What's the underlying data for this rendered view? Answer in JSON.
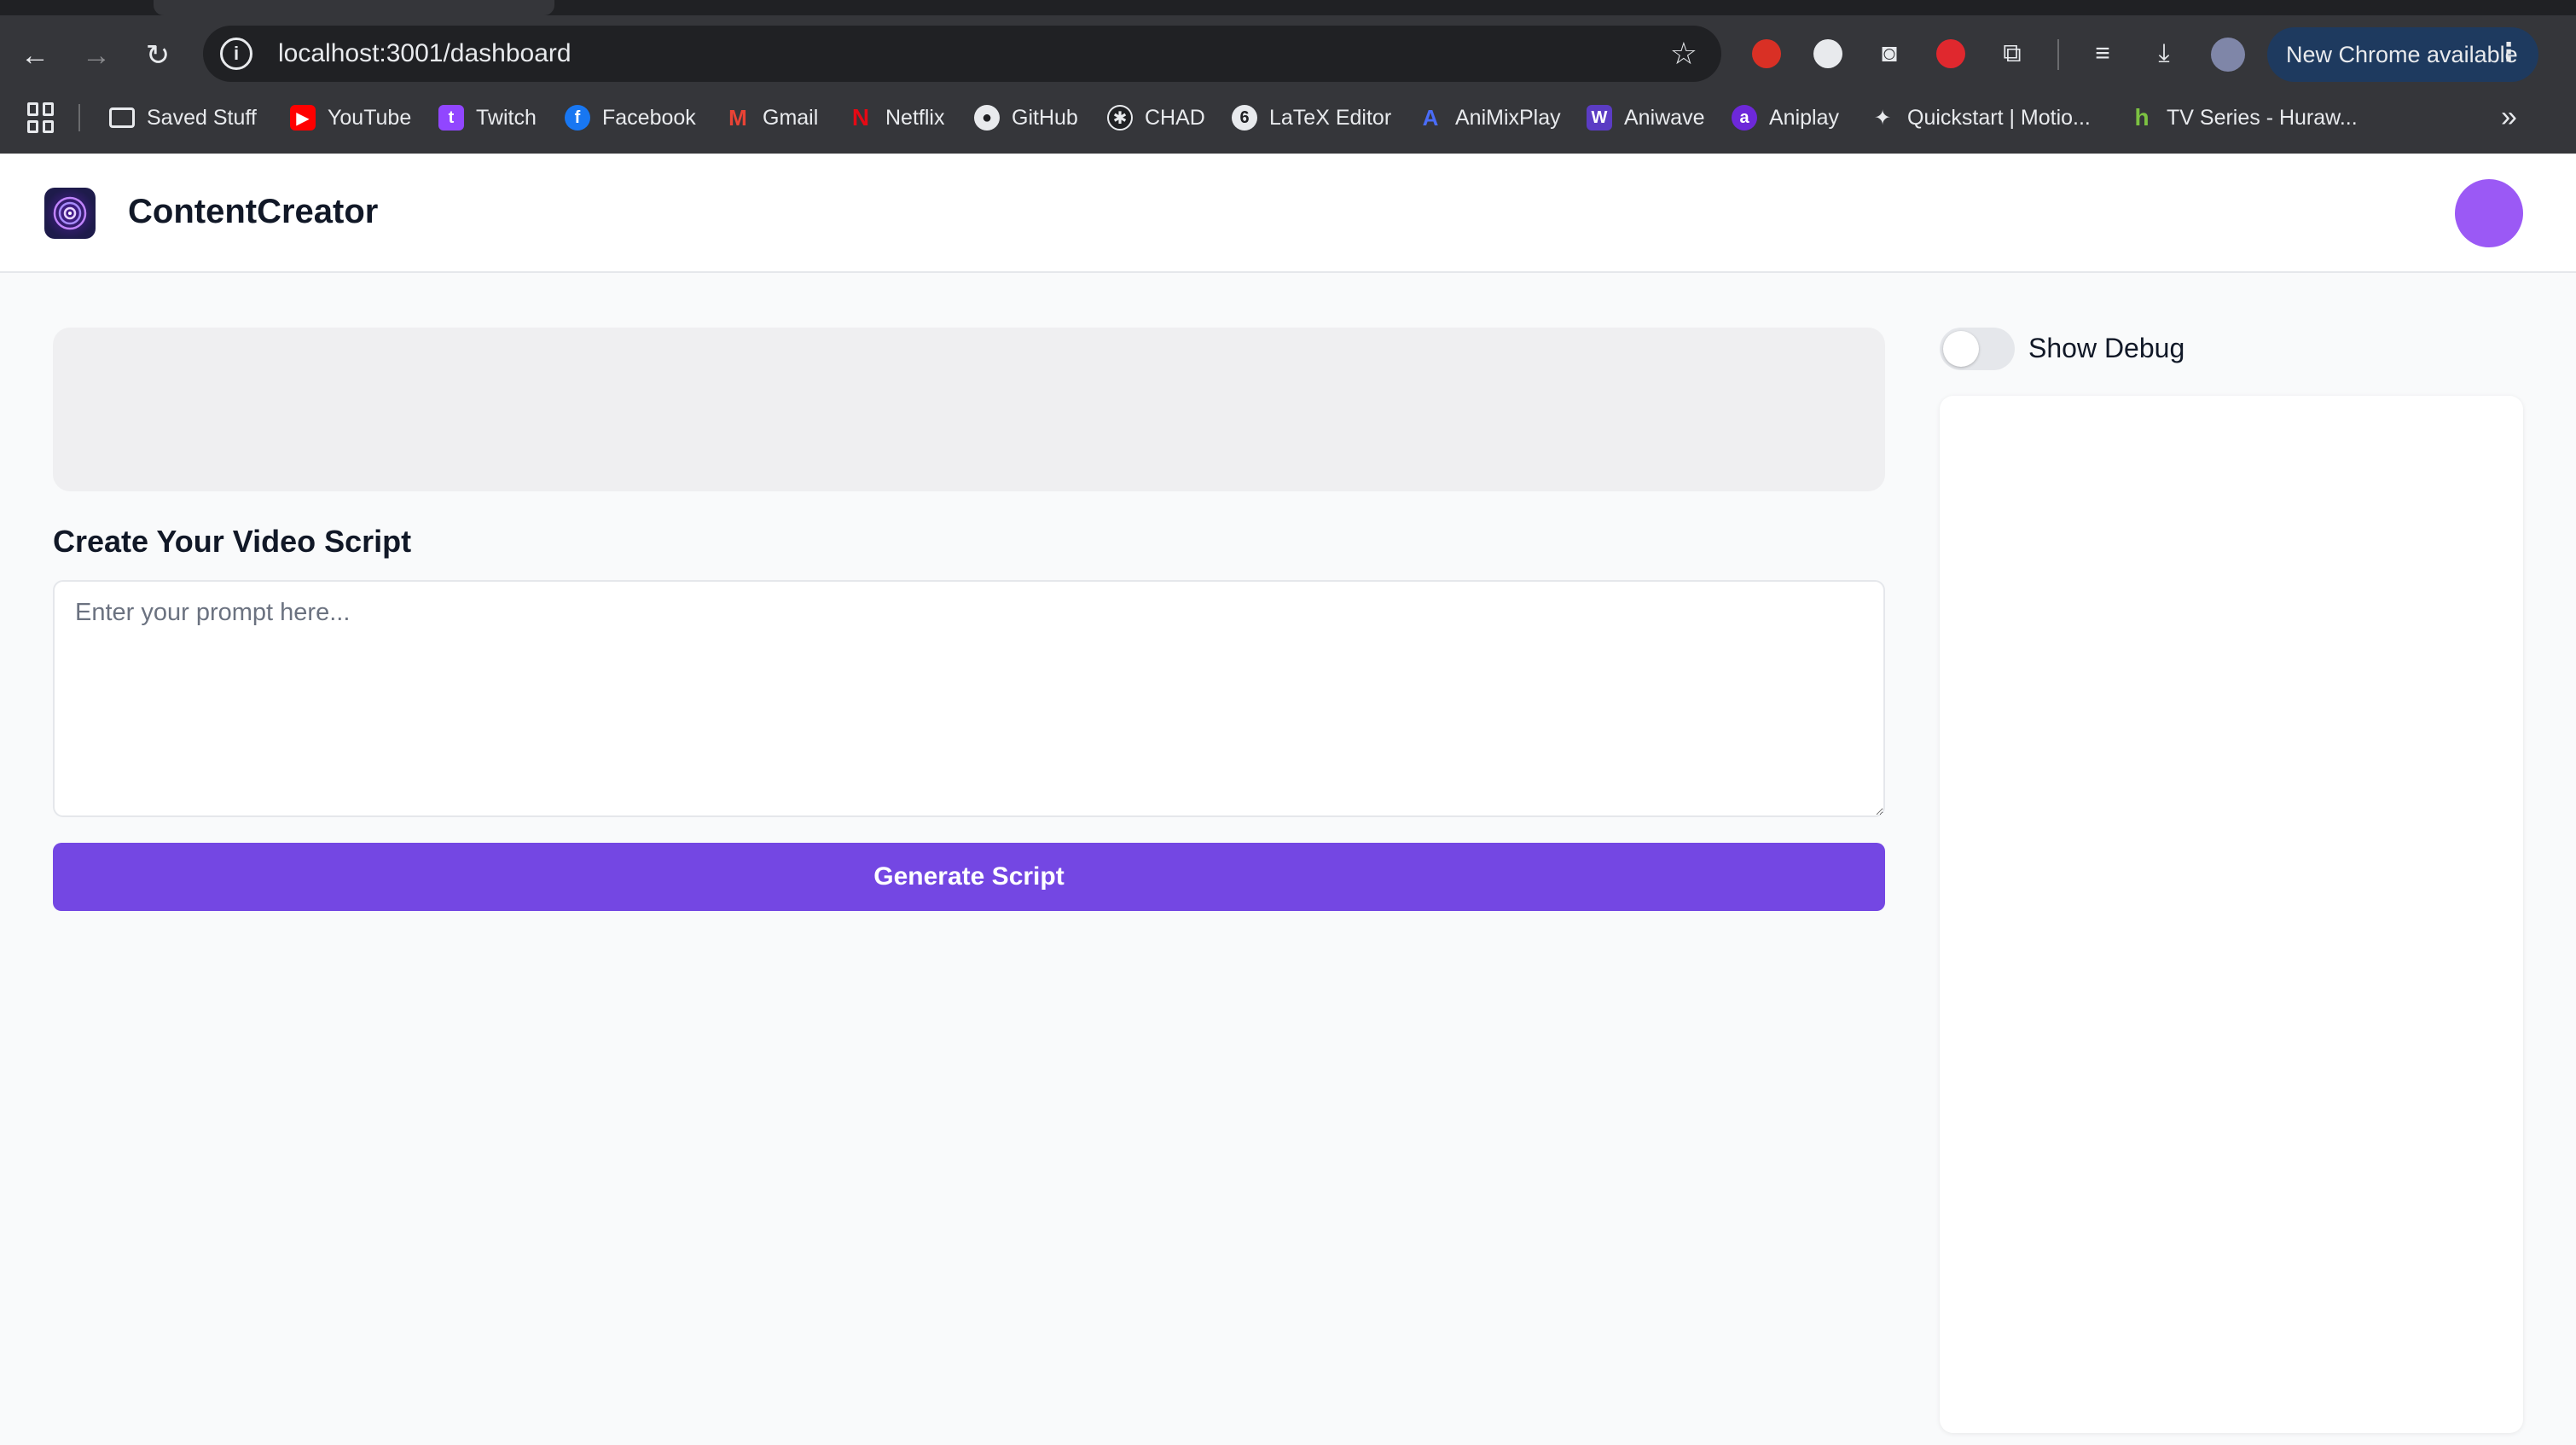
{
  "browser": {
    "url": "localhost:3001/dashboard",
    "update_label": "New Chrome available",
    "bookmarks": [
      {
        "label": "Saved Stuff",
        "icon": "folder-icon"
      },
      {
        "label": "YouTube",
        "icon": "youtube-icon",
        "color": "#ff0000"
      },
      {
        "label": "Twitch",
        "icon": "twitch-icon",
        "color": "#9146ff"
      },
      {
        "label": "Facebook",
        "icon": "facebook-icon",
        "color": "#1877f2"
      },
      {
        "label": "Gmail",
        "icon": "gmail-icon",
        "color": "#ea4335"
      },
      {
        "label": "Netflix",
        "icon": "netflix-icon",
        "color": "#e50914"
      },
      {
        "label": "GitHub",
        "icon": "github-icon"
      },
      {
        "label": "CHAD",
        "icon": "openai-icon"
      },
      {
        "label": "LaTeX Editor",
        "icon": "overleaf-icon"
      },
      {
        "label": "AniMixPlay",
        "icon": "animixplay-icon",
        "color": "#4a6cf7"
      },
      {
        "label": "Aniwave",
        "icon": "aniwave-icon",
        "color": "#5b3cc4"
      },
      {
        "label": "Aniplay",
        "icon": "aniplay-icon",
        "color": "#6d28d9"
      },
      {
        "label": "Quickstart | Motio...",
        "icon": "motion-icon"
      },
      {
        "label": "TV Series - Huraw...",
        "icon": "huraw-icon",
        "color": "#7cc242"
      }
    ]
  },
  "app": {
    "title": "ContentCreator",
    "accent": "#7447e3",
    "avatar_color": "#9b59f5"
  },
  "main": {
    "section_title": "Create Your Video Script",
    "prompt_placeholder": "Enter your prompt here...",
    "prompt_value": "",
    "generate_label": "Generate Script"
  },
  "debug": {
    "label": "Show Debug",
    "enabled": false
  }
}
